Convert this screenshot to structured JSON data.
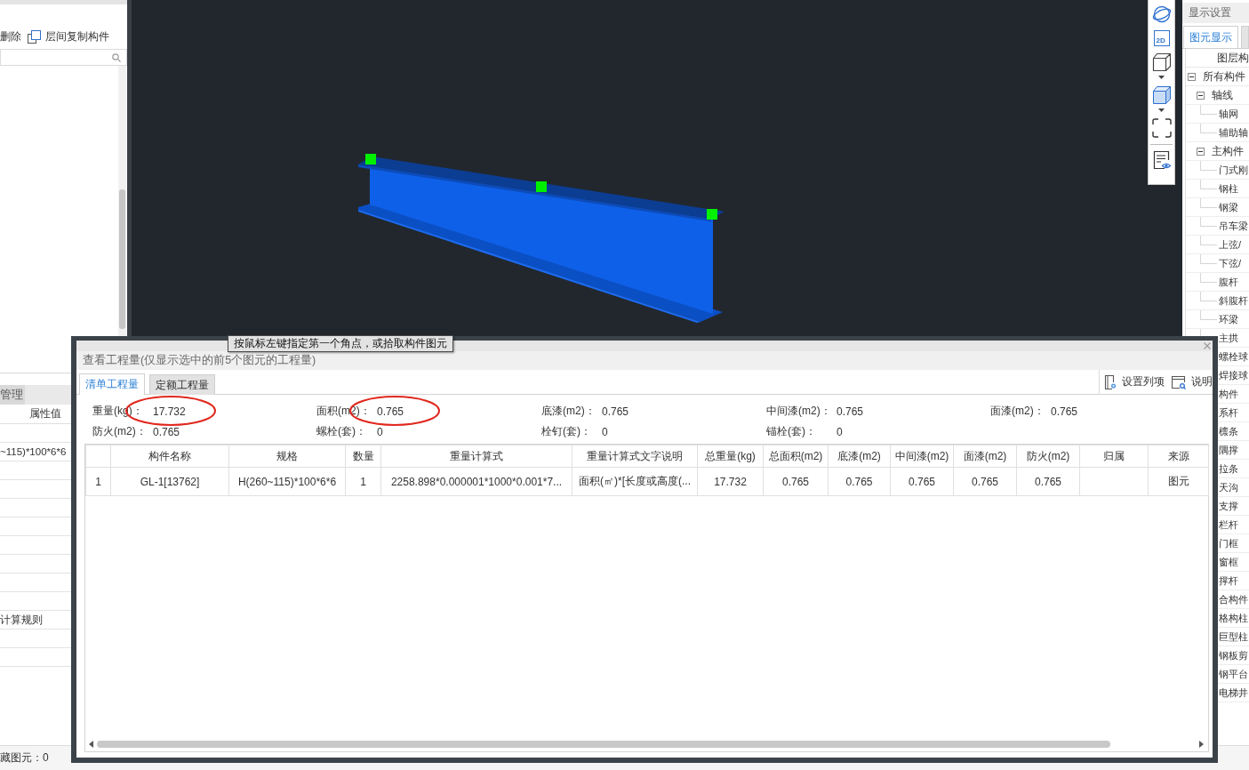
{
  "left_panel": {
    "toolbar": [
      {
        "label": "删除",
        "icon": false
      },
      {
        "label": "层间复制构件",
        "icon": true
      }
    ],
    "property_tabs": [
      {
        "label": "管理",
        "selected": false
      }
    ],
    "property_table": {
      "columns": [
        "属性值"
      ],
      "rows": [
        {},
        {
          "value": "~115)*100*6*6"
        },
        {},
        {},
        {},
        {},
        {},
        {},
        {},
        {},
        {
          "value": "计算规则"
        },
        {},
        {}
      ]
    },
    "status": "藏图元：0"
  },
  "viewport": {
    "beam": {
      "selected": true
    }
  },
  "view_toolbar": [
    {
      "kind": "orbit",
      "dropdown": false
    },
    {
      "kind": "plane",
      "label": "2D",
      "dropdown": false
    },
    {
      "kind": "wireframe",
      "dropdown": true
    },
    {
      "kind": "solid",
      "dropdown": true
    },
    {
      "kind": "frame",
      "dropdown": false
    },
    {
      "kind": "visibility",
      "dropdown": false
    }
  ],
  "right_panel": {
    "title": "显示设置",
    "tabs": [
      {
        "label": "图元显示",
        "selected": true
      },
      {
        "selected": false
      }
    ],
    "tree_header": "图层构",
    "tree": [
      {
        "label": "所有构件",
        "expanded": true,
        "children": [
          {
            "label": "轴线",
            "expanded": true,
            "children": [
              {
                "label": "轴网"
              },
              {
                "label": "辅助轴"
              }
            ]
          },
          {
            "label": "主构件",
            "expanded": true,
            "children": [
              {
                "label": "门式刚"
              },
              {
                "label": "钢柱"
              },
              {
                "label": "钢梁"
              },
              {
                "label": "吊车梁"
              },
              {
                "label": "上弦/"
              },
              {
                "label": "下弦/"
              },
              {
                "label": "腹杆"
              },
              {
                "label": "斜腹杆"
              },
              {
                "label": "环梁"
              },
              {
                "label": "主拱"
              },
              {
                "label": "螺栓球"
              },
              {
                "label": "焊接球"
              },
              {
                "label": "构件"
              },
              {
                "label": "系杆"
              },
              {
                "label": "檩条"
              },
              {
                "label": "隅撑"
              },
              {
                "label": "拉条"
              },
              {
                "label": "天沟"
              },
              {
                "label": "支撑"
              },
              {
                "label": "栏杆"
              },
              {
                "label": "门框"
              },
              {
                "label": "窗框"
              },
              {
                "label": "撑杆"
              },
              {
                "label": "合构件"
              },
              {
                "label": "格构柱"
              },
              {
                "label": "巨型柱"
              },
              {
                "label": "钢板剪"
              },
              {
                "label": "钢平台"
              },
              {
                "label": "电梯井"
              }
            ]
          }
        ]
      }
    ]
  },
  "dialog": {
    "title": "查看工程量(仅显示选中的前5个图元的工程量)",
    "tabs": [
      {
        "label": "清单工程量",
        "selected": true
      },
      {
        "label": "定额工程量",
        "selected": false
      }
    ],
    "actions": [
      {
        "kind": "settings",
        "label": "设置列项"
      },
      {
        "kind": "help",
        "label": "说明"
      }
    ],
    "summary": [
      {
        "label": "重量(kg)：",
        "value": "17.732",
        "highlighted": true
      },
      {
        "label": "面积(m2)：",
        "value": "0.765",
        "highlighted": true
      },
      {
        "label": "底漆(m2)：",
        "value": "0.765",
        "highlighted": false
      },
      {
        "label": "中间漆(m2)：",
        "value": "0.765",
        "highlighted": false
      },
      {
        "label": "面漆(m2)：",
        "value": "0.765",
        "highlighted": false
      },
      {
        "label": "防火(m2)：",
        "value": "0.765",
        "highlighted": false
      },
      {
        "label": "螺栓(套)：",
        "value": "0",
        "highlighted": false
      },
      {
        "label": "栓钉(套)：",
        "value": "0",
        "highlighted": false
      },
      {
        "label": "锚栓(套)：",
        "value": "0",
        "highlighted": false
      }
    ],
    "table": {
      "columns": [
        "构件名称",
        "规格",
        "数量",
        "重量计算式",
        "重量计算式文字说明",
        "总重量(kg)",
        "总面积(m2)",
        "底漆(m2)",
        "中间漆(m2)",
        "面漆(m2)",
        "防火(m2)",
        "归属",
        "来源"
      ],
      "rows": [
        {
          "index": "1",
          "cells": [
            "GL-1[13762]",
            "H(260~115)*100*6*6",
            "1",
            "2258.898*0.000001*1000*0.001*7...",
            "面积(㎡)*[长度或高度(...",
            "17.732",
            "0.765",
            "0.765",
            "0.765",
            "0.765",
            "0.765",
            null,
            "图元"
          ]
        }
      ]
    }
  },
  "tooltip": "按鼠标左键指定第一个角点，或拾取构件图元"
}
